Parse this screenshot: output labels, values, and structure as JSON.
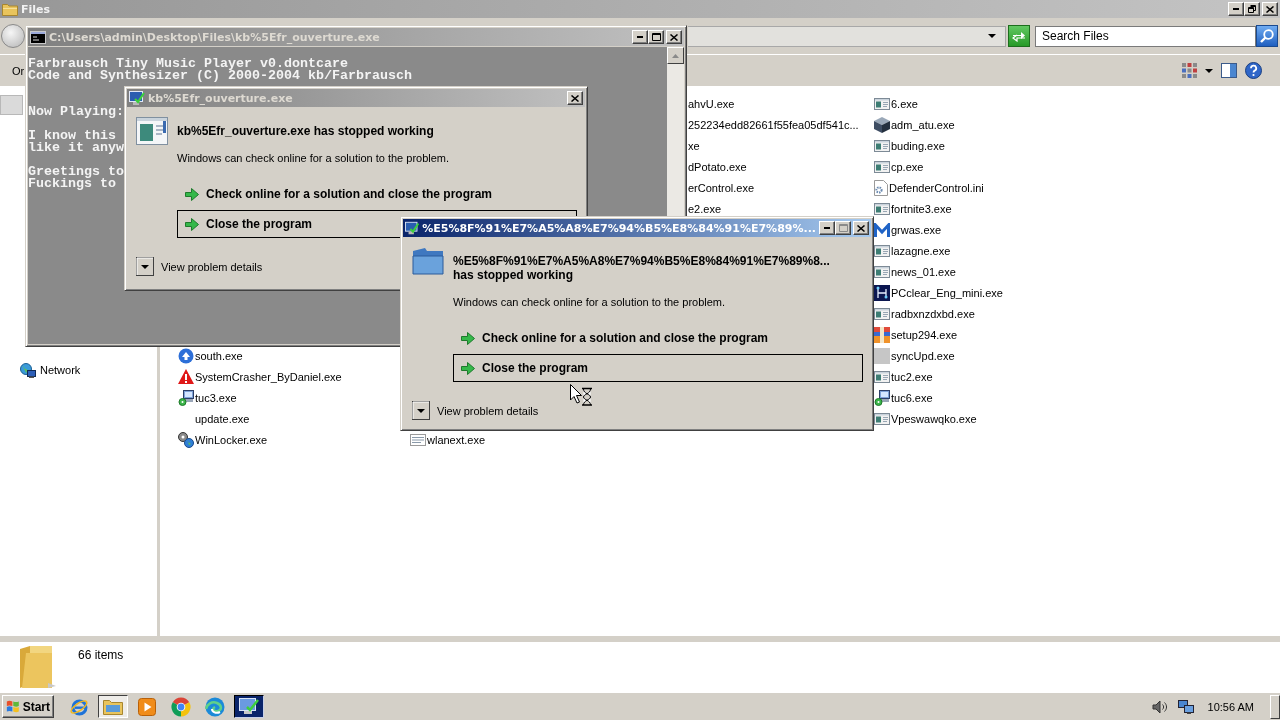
{
  "explorer": {
    "title": "Files",
    "search": {
      "placeholder": "Search Files"
    },
    "toolbar": {
      "menu": "Or"
    },
    "nav": {
      "items": [
        {
          "selected": true
        },
        {
          "label": "Network",
          "kind": "network",
          "selected": false
        }
      ]
    },
    "files": {
      "columns": [
        [
          {
            "name": "south.exe",
            "kind": "arrows"
          },
          {
            "name": "SystemCrasher_ByDaniel.exe",
            "kind": "warning"
          },
          {
            "name": "tuc3.exe",
            "kind": "setup"
          },
          {
            "name": "update.exe",
            "kind": "blank"
          },
          {
            "name": "WinLocker.exe",
            "kind": "gears"
          }
        ],
        [
          {
            "name": "wlanext.exe",
            "kind": "lines"
          }
        ],
        [
          {
            "name": "ahvU.exe"
          },
          {
            "name": "252234edd82661f55fea05df541c..."
          },
          {
            "name": "xe"
          },
          {
            "name": "dPotato.exe"
          },
          {
            "name": "erControl.exe"
          },
          {
            "name": "e2.exe"
          }
        ],
        [
          {
            "name": "6.exe",
            "kind": "window"
          },
          {
            "name": "adm_atu.exe",
            "kind": "cube"
          },
          {
            "name": "buding.exe",
            "kind": "window"
          },
          {
            "name": "cp.exe",
            "kind": "window"
          },
          {
            "name": "DefenderControl.ini",
            "kind": "settings"
          },
          {
            "name": "fortnite3.exe",
            "kind": "window"
          },
          {
            "name": "grwas.exe",
            "kind": "zigzag"
          },
          {
            "name": "lazagne.exe",
            "kind": "window"
          },
          {
            "name": "news_01.exe",
            "kind": "window"
          },
          {
            "name": "PCclear_Eng_mini.exe",
            "kind": "nodes"
          },
          {
            "name": "radbxnzdxbd.exe",
            "kind": "window"
          },
          {
            "name": "setup294.exe",
            "kind": "striped"
          },
          {
            "name": "syncUpd.exe",
            "kind": "tile"
          },
          {
            "name": "tuc2.exe",
            "kind": "window"
          },
          {
            "name": "tuc6.exe",
            "kind": "setup"
          },
          {
            "name": "Vpeswawqko.exe",
            "kind": "window"
          }
        ]
      ]
    },
    "status": {
      "count": "66 items"
    }
  },
  "console": {
    "title": "C:\\Users\\admin\\Desktop\\Files\\kb%5Efr_ouverture.exe",
    "blocks": [
      {
        "lines": [
          "Farbrausch Tiny Music Player v0.dontcare",
          "Code and Synthesizer (C) 2000-2004 kb/Farbrausch"
        ]
      },
      {
        "lines": [
          "Now Playing:"
        ]
      },
      {
        "lines": [
          "I know this",
          "like it anyw"
        ]
      },
      {
        "lines": [
          "Greetings to",
          "Fuckings to"
        ]
      }
    ]
  },
  "dialogs": [
    {
      "title": "kb%5Efr_ouverture.exe",
      "active": false,
      "window_buttons": false,
      "kind": "app",
      "heading": "kb%5Efr_ouverture.exe has stopped working",
      "message": "Windows can check online for a solution to the problem.",
      "options": [
        {
          "label": "Check online for a solution and close the program",
          "selected": false
        },
        {
          "label": "Close the program",
          "selected": true
        }
      ],
      "details": "View problem details"
    },
    {
      "title": "%E5%8F%91%E7%A5%A8%E7%94%B5%E8%84%91%E7%89%...",
      "active": true,
      "window_buttons": true,
      "kind": "folder",
      "heading": "%E5%8F%91%E7%A5%A8%E7%94%B5%E8%84%91%E7%89%8... has stopped working",
      "message": "Windows can check online for a solution to the problem.",
      "options": [
        {
          "label": "Check online for a solution and close the program",
          "selected": false
        },
        {
          "label": "Close the program",
          "selected": true
        }
      ],
      "details": "View problem details"
    }
  ],
  "taskbar": {
    "start": "Start",
    "apps": [
      {
        "kind": "orbit",
        "running": false,
        "selected": false
      },
      {
        "kind": "folder",
        "running": true,
        "selected": false
      },
      {
        "kind": "media",
        "running": false,
        "selected": false
      },
      {
        "kind": "tricolor",
        "running": false,
        "selected": false
      },
      {
        "kind": "swirl",
        "running": false,
        "selected": false
      },
      {
        "kind": "report",
        "running": true,
        "selected": true
      }
    ],
    "clock": "10:56 AM"
  }
}
